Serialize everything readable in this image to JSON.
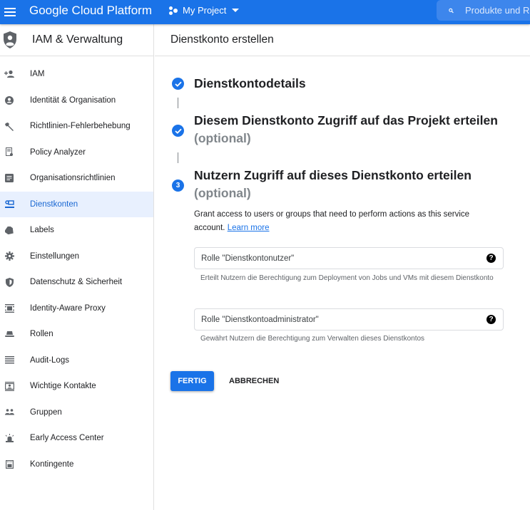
{
  "topbar": {
    "brand": "Google Cloud Platform",
    "project": "My Project",
    "search_placeholder": "Produkte und Ressourcen suchen",
    "accent": "#1a73e8"
  },
  "sidebar": {
    "title": "IAM & Verwaltung",
    "items": [
      {
        "label": "IAM",
        "icon": "person-add-icon"
      },
      {
        "label": "Identität & Organisation",
        "icon": "account-circle-icon"
      },
      {
        "label": "Richtlinien-Fehlerbehebung",
        "icon": "wrench-icon"
      },
      {
        "label": "Policy Analyzer",
        "icon": "document-search-icon"
      },
      {
        "label": "Organisationsrichtlinien",
        "icon": "list-document-icon"
      },
      {
        "label": "Dienstkonten",
        "icon": "service-account-icon",
        "active": true
      },
      {
        "label": "Labels",
        "icon": "label-icon"
      },
      {
        "label": "Einstellungen",
        "icon": "gear-icon"
      },
      {
        "label": "Datenschutz & Sicherheit",
        "icon": "shield-icon"
      },
      {
        "label": "Identity-Aware Proxy",
        "icon": "proxy-icon"
      },
      {
        "label": "Rollen",
        "icon": "hat-icon"
      },
      {
        "label": "Audit-Logs",
        "icon": "lines-icon"
      },
      {
        "label": "Wichtige Kontakte",
        "icon": "contact-card-icon"
      },
      {
        "label": "Gruppen",
        "icon": "group-icon"
      },
      {
        "label": "Early Access Center",
        "icon": "alarm-light-icon"
      },
      {
        "label": "Kontingente",
        "icon": "quota-icon"
      }
    ]
  },
  "main": {
    "title": "Dienstkonto erstellen",
    "steps": [
      {
        "title": "Dienstkontodetails",
        "state": "done"
      },
      {
        "title": "Diesem Dienstkonto Zugriff auf das Projekt erteilen",
        "optional": "(optional)",
        "state": "done"
      },
      {
        "number": "3",
        "title": "Nutzern Zugriff auf dieses Dienstkonto erteilen",
        "optional": "(optional)",
        "state": "active"
      }
    ],
    "description": "Grant access to users or groups that need to perform actions as this service account.",
    "learn_more": "Learn more",
    "fields": [
      {
        "placeholder": "Rolle \"Dienstkontonutzer\"",
        "hint": "Erteilt Nutzern die Berechtigung zum Deployment von Jobs und VMs mit diesem Dienstkonto"
      },
      {
        "placeholder": "Rolle \"Dienstkontoadministrator\"",
        "hint": "Gewährt Nutzern die Berechtigung zum Verwalten dieses Dienstkontos"
      }
    ],
    "done_label": "FERTIG",
    "cancel_label": "ABBRECHEN"
  }
}
